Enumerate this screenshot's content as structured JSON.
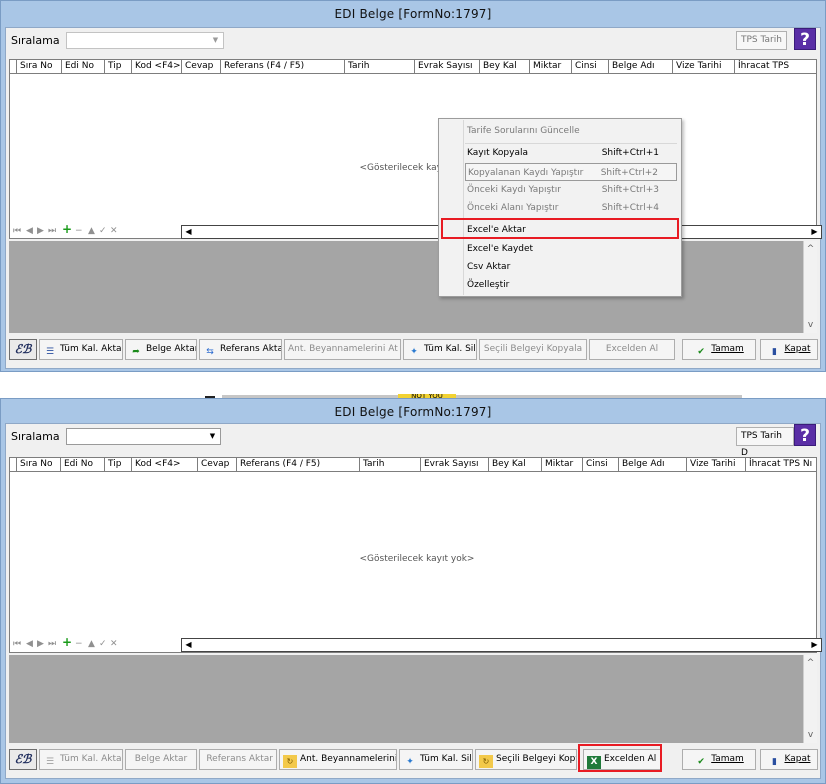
{
  "top": {
    "title": "EDI Belge  [FormNo:1797]",
    "sort_label": "Sıralama",
    "combo_arrow": "▼",
    "tps_button": "TPS Tarih",
    "help": "?",
    "columns": [
      "Sıra No",
      "Edi No",
      "Tip",
      "Kod <F4>",
      "Cevap",
      "Referans (F4 / F5)",
      "Tarih",
      "Evrak Sayısı",
      "Bey Kal",
      "Miktar",
      "Cinsi",
      "Belge Adı",
      "Vize Tarihi",
      "İhracat TPS"
    ],
    "empty_text": "<Gösterilecek kayıt yok>",
    "nav_icons": [
      "⏮",
      "◀",
      "▶",
      "⏭",
      "+",
      "−",
      "▲",
      "✓",
      "✕"
    ],
    "toolbar": {
      "sg": "ℰℬ",
      "all_kal": "Tüm Kal. Aktar",
      "belge_aktar": "Belge Aktar",
      "ref_aktar": "Referans Aktar",
      "ant_beyan": "Ant. Beyannamelerini At",
      "tum_kal_sil": "Tüm Kal. Sil",
      "secili_kopyala": "Seçili Belgeyi Kopyala",
      "excelden_al": "Excelden Al",
      "tamam": "Tamam",
      "kapat": "Kapat"
    }
  },
  "context_menu": [
    {
      "label": "Tarife Sorularını Güncelle",
      "shortcut": "",
      "disabled": true
    },
    {
      "label": "Kayıt Kopyala",
      "shortcut": "Shift+Ctrl+1",
      "disabled": false
    },
    {
      "label": "Kopyalanan Kaydı Yapıştır",
      "shortcut": "Shift+Ctrl+2",
      "disabled": true,
      "highlight": true
    },
    {
      "label": "Önceki Kaydı Yapıştır",
      "shortcut": "Shift+Ctrl+3",
      "disabled": true
    },
    {
      "label": "Önceki Alanı Yapıştır",
      "shortcut": "Shift+Ctrl+4",
      "disabled": true
    },
    {
      "label": "Excel'e Aktar",
      "shortcut": "",
      "disabled": false
    },
    {
      "label": "Excel'e Kaydet",
      "shortcut": "",
      "disabled": false
    },
    {
      "label": "Csv Aktar",
      "shortcut": "",
      "disabled": false
    },
    {
      "label": "Özelleştir",
      "shortcut": "",
      "disabled": false
    }
  ],
  "mid_text": "NOT YOU",
  "bottom": {
    "title": "EDI Belge  [FormNo:1797]",
    "sort_label": "Sıralama",
    "combo_arrow": "▼",
    "tps_button": "TPS Tarih D",
    "help": "?",
    "columns": [
      "Sıra No",
      "Edi No",
      "Tip",
      "Kod <F4>",
      "Cevap",
      "Referans (F4 / F5)",
      "Tarih",
      "Evrak Sayısı",
      "Bey Kal",
      "Miktar",
      "Cinsi",
      "Belge Adı",
      "Vize Tarihi",
      "İhracat TPS Nı"
    ],
    "empty_text": "<Gösterilecek kayıt yok>",
    "toolbar": {
      "sg": "ℰℬ",
      "all_kal": "Tüm Kal. Aktar",
      "belge_aktar": "Belge Aktar",
      "ref_aktar": "Referans Aktar",
      "ant_beyan": "Ant. Beyannamelerini At",
      "tum_kal_sil": "Tüm Kal. Sil",
      "secili_kopyala": "Seçili Belgeyi Kopyala",
      "excelden_al": "Excelden Al",
      "tamam": "Tamam",
      "kapat": "Kapat"
    }
  },
  "colors": {
    "highlight_border": "#e81b23",
    "help_bg": "#5a2ea6",
    "frame": "#a9c6e6"
  }
}
